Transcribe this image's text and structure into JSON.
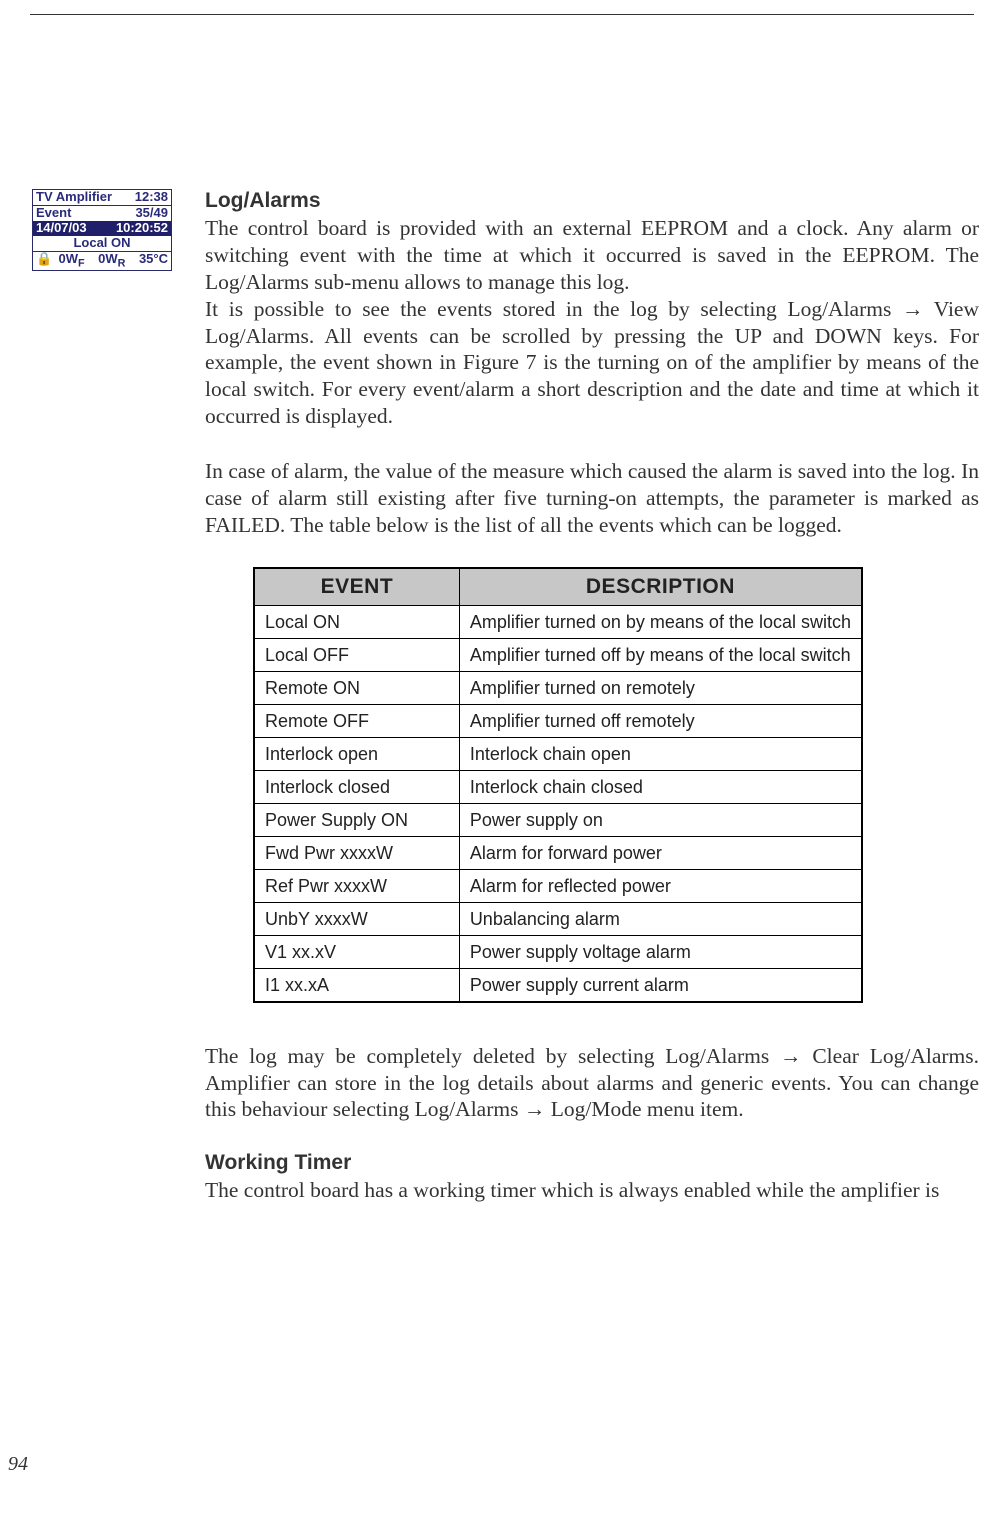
{
  "lcd": {
    "title_left": "TV Amplifier",
    "title_right": "12:38",
    "row2_left": "Event",
    "row2_right": "35/49",
    "row3_left": "14/07/03",
    "row3_right": "10:20:52",
    "row4": "Local ON",
    "row5_lock": "🔒",
    "row5_a": "0W",
    "row5_a_sub": "F",
    "row5_b": "0W",
    "row5_b_sub": "R",
    "row5_c": "35°C"
  },
  "section1": {
    "heading": "Log/Alarms",
    "para1": "The control board is provided with an external EEPROM and a clock. Any alarm or switching event with the time at which it occurred is saved in the EEPROM. The Log/Alarms sub-menu allows to manage this log.",
    "para2": "It is possible to see the events stored in the log by selecting Log/Alarms → View Log/Alarms. All events can be scrolled by pressing the UP and DOWN keys. For example, the event shown in Figure 7 is the turning on of the amplifier by means of the local switch. For every event/alarm a short description and the date and time at which it occurred is displayed.",
    "para3": "In case of alarm, the value of the measure which caused the alarm is saved into the log. In case of alarm still existing after five turning-on attempts, the parameter is marked as FAILED. The table below is the list of all the events which can be logged."
  },
  "table": {
    "header_event": "EVENT",
    "header_desc": "DESCRIPTION",
    "rows": [
      {
        "event": "Local ON",
        "desc": "Amplifier turned on by means of the local switch"
      },
      {
        "event": "Local OFF",
        "desc": "Amplifier turned off by means of the local switch"
      },
      {
        "event": "Remote ON",
        "desc": "Amplifier turned on remotely"
      },
      {
        "event": "Remote OFF",
        "desc": "Amplifier turned off remotely"
      },
      {
        "event": "Interlock open",
        "desc": "Interlock chain open"
      },
      {
        "event": "Interlock closed",
        "desc": "Interlock chain closed"
      },
      {
        "event": "Power Supply ON",
        "desc": "Power supply on"
      },
      {
        "event": "Fwd Pwr xxxxW",
        "desc": "Alarm for forward power"
      },
      {
        "event": "Ref Pwr xxxxW",
        "desc": "Alarm for reflected power"
      },
      {
        "event": "UnbY xxxxW",
        "desc": "Unbalancing alarm"
      },
      {
        "event": "V1 xx.xV",
        "desc": "Power supply voltage alarm"
      },
      {
        "event": "I1 xx.xA",
        "desc": "Power supply current alarm"
      }
    ]
  },
  "after_table": {
    "para1": "The log may be completely deleted by selecting Log/Alarms → Clear Log/Alarms. Amplifier can store in the log details about alarms and generic events. You can change this behaviour selecting Log/Alarms → Log/Mode menu item."
  },
  "section2": {
    "heading": "Working Timer",
    "para1": "The control board has a working timer which is always enabled while the amplifier is"
  },
  "page_number": "94"
}
